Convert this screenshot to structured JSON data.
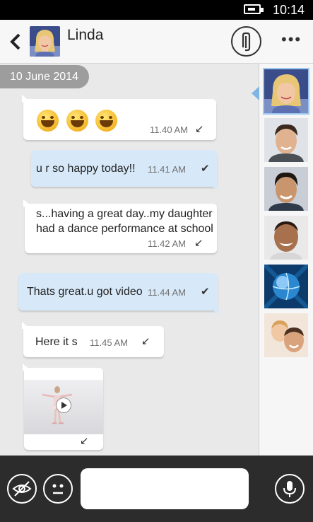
{
  "status": {
    "time": "10:14",
    "battery_icon": "battery-charging-icon"
  },
  "header": {
    "contact_name": "Linda",
    "attach_icon": "paperclip-icon",
    "more_label": "•••"
  },
  "chat": {
    "date": "10 June 2014",
    "messages": [
      {
        "type": "emoji",
        "direction": "in",
        "emojis": [
          "grinning-face",
          "grinning-face",
          "grinning-face"
        ],
        "time": "11.40 AM",
        "status_icon": "received-arrow-icon"
      },
      {
        "type": "text",
        "direction": "out",
        "text": "u r so happy today!!",
        "time": "11.41 AM",
        "status_icon": "sent-check-icon"
      },
      {
        "type": "text",
        "direction": "in",
        "lines": [
          "s...having a great day..my daughter",
          "had a dance performance at school"
        ],
        "time": "11.42 AM",
        "status_icon": "received-arrow-icon"
      },
      {
        "type": "text",
        "direction": "out",
        "text": "Thats great.u got video",
        "time": "11.44 AM",
        "status_icon": "sent-check-icon"
      },
      {
        "type": "text",
        "direction": "in",
        "text": "Here it s",
        "time": "11.45 AM",
        "status_icon": "received-arrow-icon"
      },
      {
        "type": "video",
        "direction": "in",
        "status_icon": "received-arrow-icon"
      }
    ]
  },
  "contacts": [
    "contact-linda",
    "contact-man-1",
    "contact-man-2",
    "contact-man-3",
    "contact-globe",
    "contact-family"
  ],
  "bottom": {
    "privacy_icon": "eye-off-icon",
    "emoji_icon": "neutral-face-icon",
    "input_placeholder": "",
    "mic_icon": "microphone-icon"
  },
  "colors": {
    "incoming_bubble": "#ffffff",
    "outgoing_bubble": "#d7e9f9",
    "chat_background": "#e9e9e9",
    "bottom_bar": "#2c2c2c"
  }
}
